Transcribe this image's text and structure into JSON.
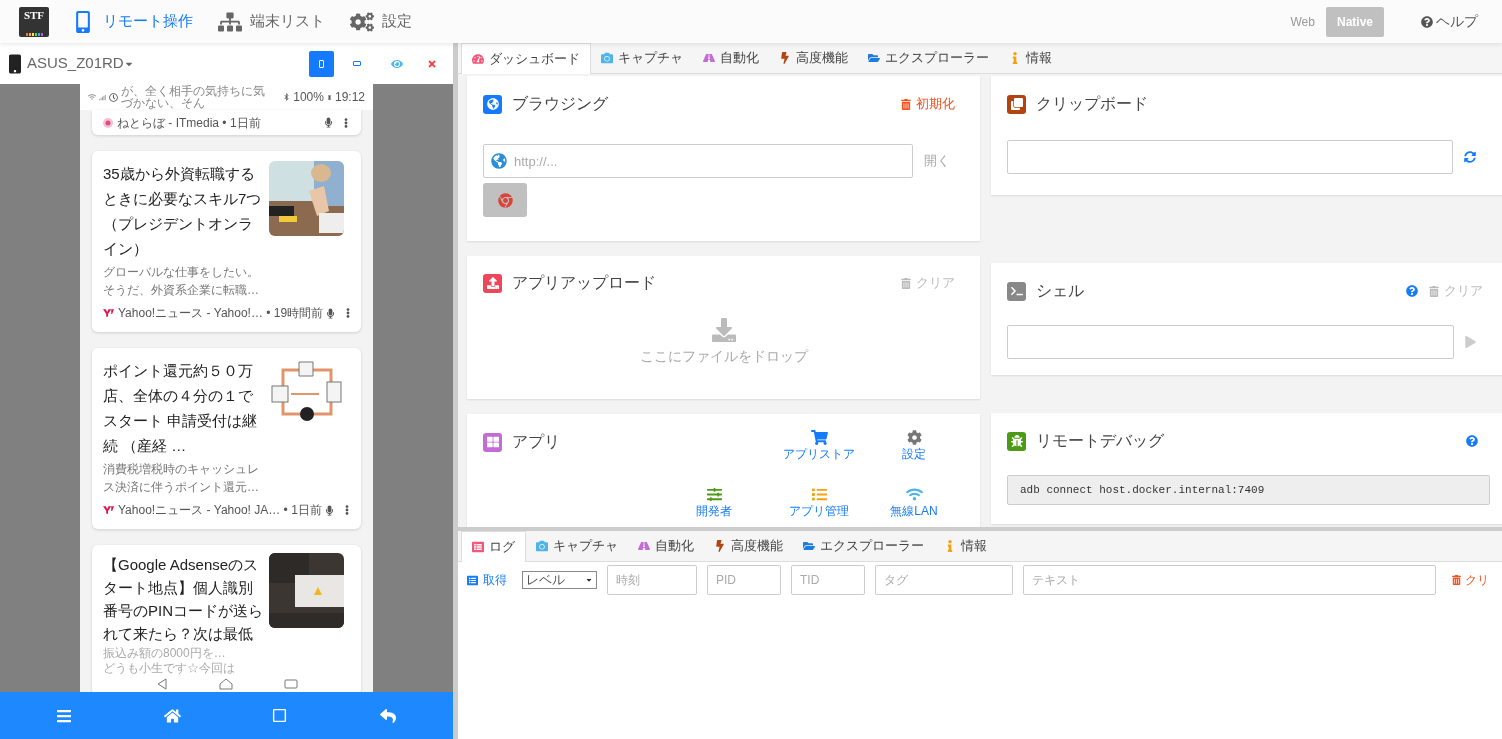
{
  "topbar": {
    "logo": "STF",
    "nav": [
      {
        "label": "リモート操作",
        "selected": true
      },
      {
        "label": "端末リスト",
        "selected": false
      },
      {
        "label": "設定",
        "selected": false
      }
    ],
    "mode": [
      {
        "label": "Web",
        "selected": false
      },
      {
        "label": "Native",
        "selected": true
      }
    ],
    "help": "ヘルプ"
  },
  "device": {
    "name": "ASUS_Z01RD",
    "orientation": [
      {
        "kind": "portrait",
        "selected": true
      },
      {
        "kind": "landscape",
        "selected": false
      }
    ]
  },
  "phone": {
    "status": {
      "ticker": "が、全く相手の気持ちに気づかない、そん",
      "battery": "100%",
      "time": "19:12"
    },
    "cards": [
      {
        "source": "ねとらぼ - ITmedia • 1日前"
      },
      {
        "title": "35歳から外資転職するときに必要なスキル7つ（プレジデントオンライン）",
        "summary": "グローバルな仕事をしたい。そうだ、外資系企業に転職…",
        "source": "Yahoo!ニュース - Yahoo!… • 19時間前"
      },
      {
        "title": "ポイント還元約５０万店、全体の４分の１でスタート 申請受付は継続 （産経 …",
        "summary": "消費税増税時のキャッシュレス決済に伴うポイント還元…",
        "source": "Yahoo!ニュース - Yahoo! JA… • 1日前"
      },
      {
        "title": "【Google Adsenseのスタート地点】個人識別番号のPINコードが送られて来たら？次は最低",
        "summary": "振込み額の8000円を…",
        "extra": "どうも小生です☆今回は"
      }
    ]
  },
  "tabs": [
    {
      "label": "ダッシュボード",
      "selected": true
    },
    {
      "label": "キャプチャ",
      "selected": false
    },
    {
      "label": "自動化",
      "selected": false
    },
    {
      "label": "高度機能",
      "selected": false
    },
    {
      "label": "エクスプローラー",
      "selected": false
    },
    {
      "label": "情報",
      "selected": false
    }
  ],
  "browsing": {
    "title": "ブラウジング",
    "reset": "初期化",
    "url_placeholder": "http://...",
    "open": "開く"
  },
  "upload": {
    "title": "アプリアップロード",
    "clear": "クリア",
    "drop": "ここにファイルをドロップ"
  },
  "apps": {
    "title": "アプリ",
    "actions": [
      {
        "label": "アプリストア"
      },
      {
        "label": "設定"
      },
      {
        "label": "開発者"
      },
      {
        "label": "アプリ管理"
      },
      {
        "label": "無線LAN"
      }
    ]
  },
  "clipboard": {
    "title": "クリップボード"
  },
  "shell": {
    "title": "シェル",
    "clear": "クリア"
  },
  "debug": {
    "title": "リモートデバッグ",
    "command": "adb connect host.docker.internal:7409"
  },
  "bottom_tabs": [
    {
      "label": "ログ",
      "selected": true
    },
    {
      "label": "キャプチャ",
      "selected": false
    },
    {
      "label": "自動化",
      "selected": false
    },
    {
      "label": "高度機能",
      "selected": false
    },
    {
      "label": "エクスプローラー",
      "selected": false
    },
    {
      "label": "情報",
      "selected": false
    }
  ],
  "log": {
    "get": "取得",
    "level": "レベル",
    "filters": [
      {
        "placeholder": "時刻"
      },
      {
        "placeholder": "PID"
      },
      {
        "placeholder": "TID"
      },
      {
        "placeholder": "タグ"
      },
      {
        "placeholder": "テキスト"
      }
    ],
    "clear": "クリ"
  }
}
